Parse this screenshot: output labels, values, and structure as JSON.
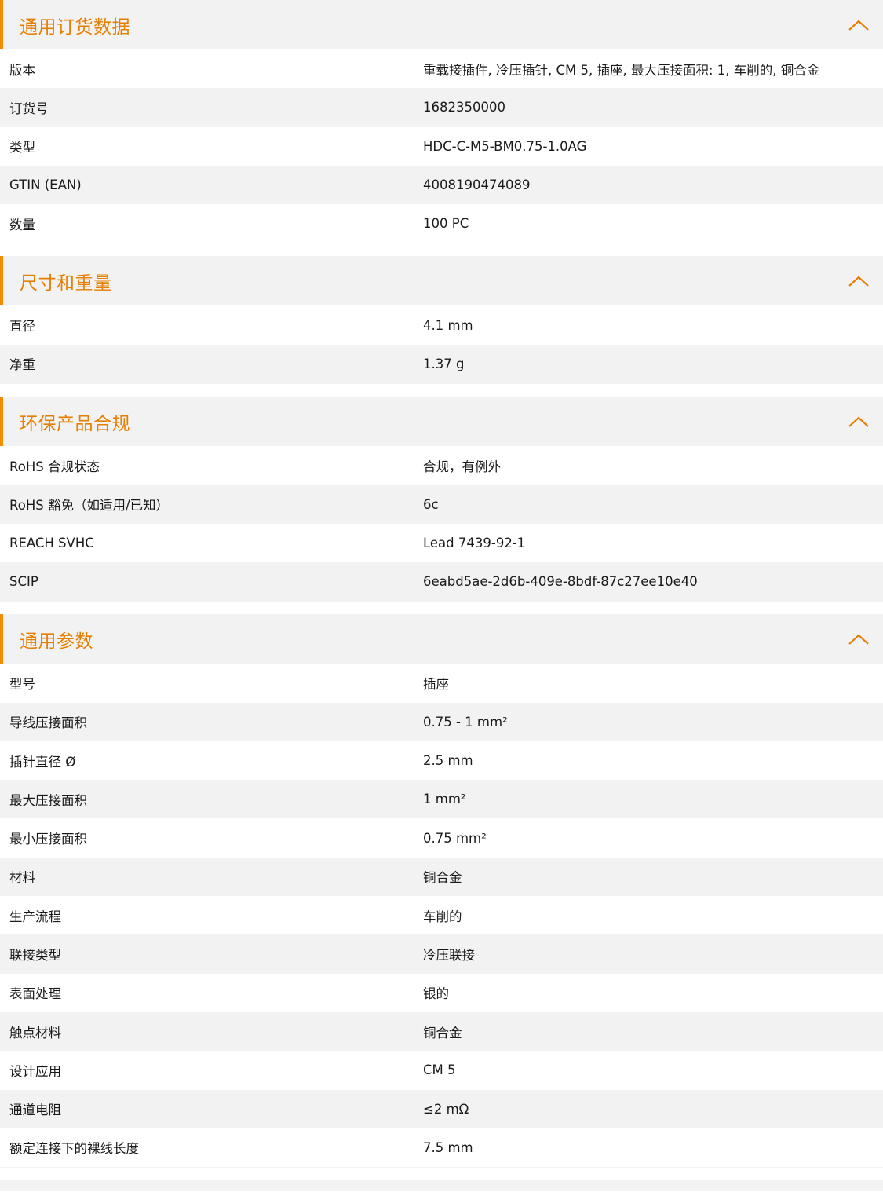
{
  "colors": {
    "accent": "#f28c00",
    "title": "#e67e00",
    "row_alt": "#f2f2f2"
  },
  "sections": [
    {
      "title": "通用订货数据",
      "icon": "chevron-up-icon",
      "rows": [
        {
          "label": "版本",
          "value": "重载接插件, 冷压插针, CM 5, 插座, 最大压接面积: 1, 车削的, 铜合金"
        },
        {
          "label": "订货号",
          "value": "1682350000"
        },
        {
          "label": "类型",
          "value": "HDC-C-M5-BM0.75-1.0AG"
        },
        {
          "label": "GTIN (EAN)",
          "value": "4008190474089"
        },
        {
          "label": "数量",
          "value": "100  PC"
        }
      ]
    },
    {
      "title": "尺寸和重量",
      "icon": "chevron-up-icon",
      "rows": [
        {
          "label": "直径",
          "value": "4.1  mm"
        },
        {
          "label": "净重",
          "value": "1.37  g"
        }
      ]
    },
    {
      "title": "环保产品合规",
      "icon": "chevron-up-icon",
      "rows": [
        {
          "label": "RoHS 合规状态",
          "value": "合规，有例外"
        },
        {
          "label": "RoHS 豁免（如适用/已知）",
          "value": "6c"
        },
        {
          "label": "REACH SVHC",
          "value": "Lead 7439-92-1"
        },
        {
          "label": "SCIP",
          "value": "6eabd5ae-2d6b-409e-8bdf-87c27ee10e40"
        }
      ]
    },
    {
      "title": "通用参数",
      "icon": "chevron-up-icon",
      "rows": [
        {
          "label": "型号",
          "value": "插座"
        },
        {
          "label": "导线压接面积",
          "value": "0.75 - 1 mm²"
        },
        {
          "label": "插针直径 Ø",
          "value": "2.5  mm"
        },
        {
          "label": "最大压接面积",
          "value": "1  mm²"
        },
        {
          "label": "最小压接面积",
          "value": "0.75  mm²"
        },
        {
          "label": "材料",
          "value": "铜合金"
        },
        {
          "label": "生产流程",
          "value": "车削的"
        },
        {
          "label": "联接类型",
          "value": "冷压联接"
        },
        {
          "label": "表面处理",
          "value": "银的"
        },
        {
          "label": "触点材料",
          "value": "铜合金"
        },
        {
          "label": "设计应用",
          "value": "CM 5"
        },
        {
          "label": "通道电阻",
          "value": "≤2 mΩ"
        },
        {
          "label": "额定连接下的裸线长度",
          "value": "7.5  mm"
        }
      ]
    }
  ]
}
